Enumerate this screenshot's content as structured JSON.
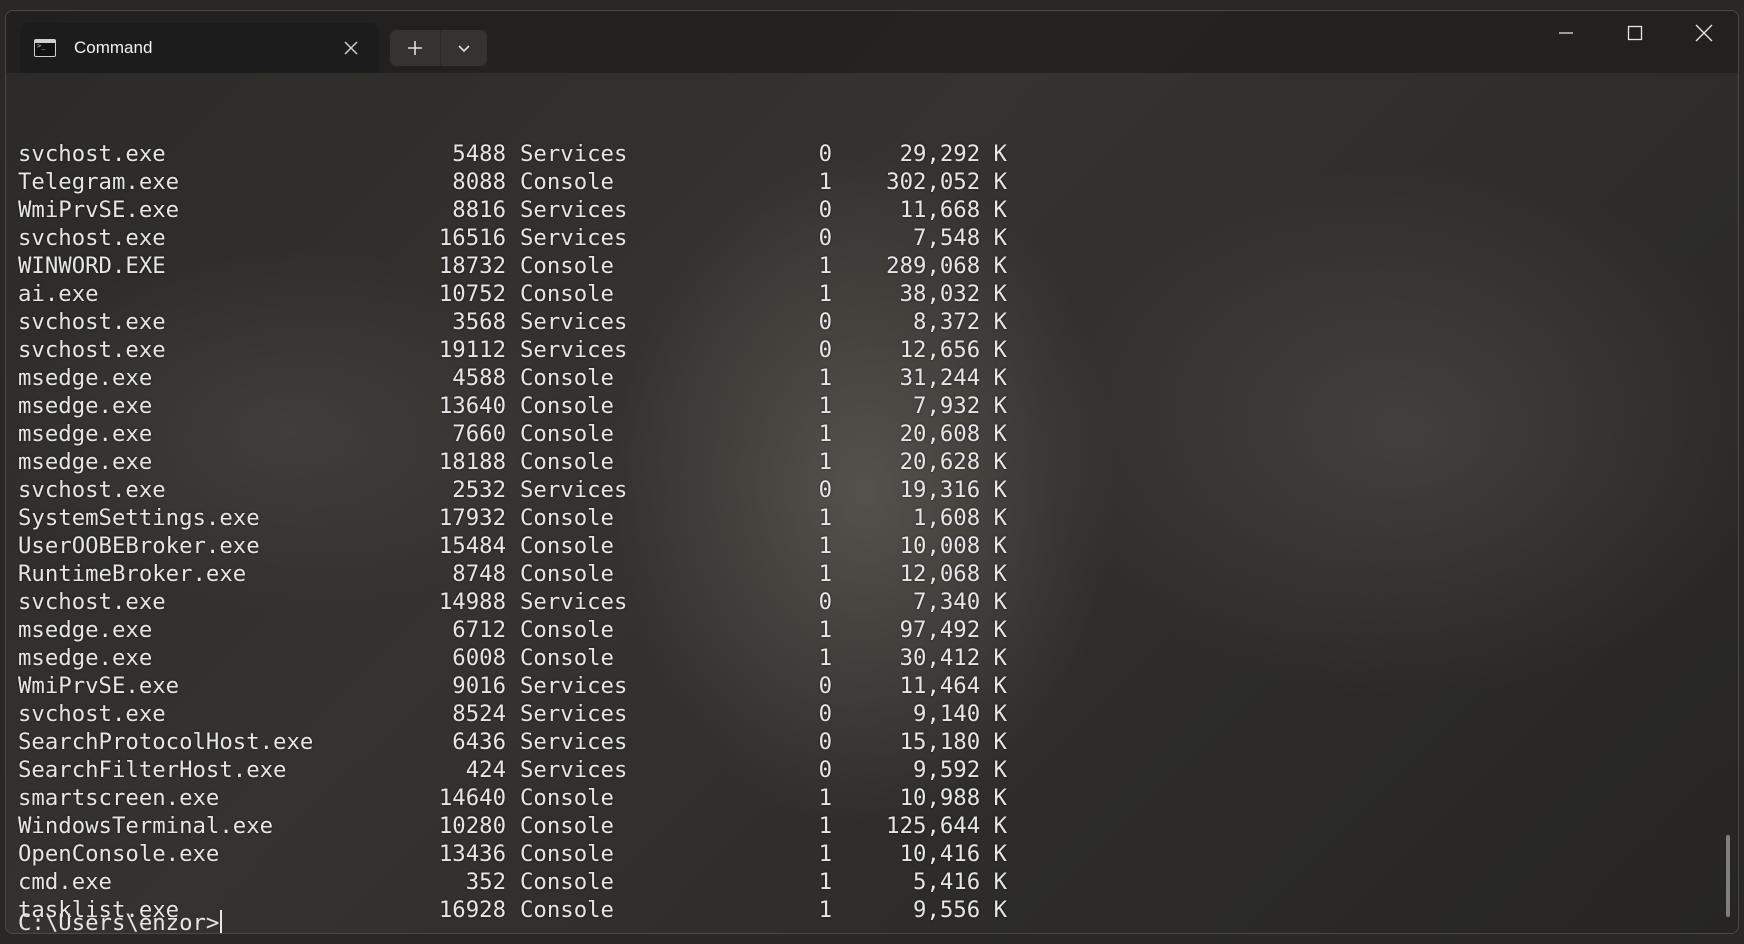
{
  "window": {
    "tab_title": "Command",
    "icons": {
      "tab": "terminal-icon",
      "close_tab": "close-icon",
      "new_tab": "plus-icon",
      "dropdown": "chevron-down-icon",
      "minimize": "minimize-icon",
      "maximize": "maximize-icon",
      "close_window": "close-icon"
    }
  },
  "terminal": {
    "rows": [
      {
        "name": "svchost.exe",
        "pid": "5488",
        "session": "Services",
        "num": "0",
        "mem": "29,292 K"
      },
      {
        "name": "Telegram.exe",
        "pid": "8088",
        "session": "Console",
        "num": "1",
        "mem": "302,052 K"
      },
      {
        "name": "WmiPrvSE.exe",
        "pid": "8816",
        "session": "Services",
        "num": "0",
        "mem": "11,668 K"
      },
      {
        "name": "svchost.exe",
        "pid": "16516",
        "session": "Services",
        "num": "0",
        "mem": "7,548 K"
      },
      {
        "name": "WINWORD.EXE",
        "pid": "18732",
        "session": "Console",
        "num": "1",
        "mem": "289,068 K"
      },
      {
        "name": "ai.exe",
        "pid": "10752",
        "session": "Console",
        "num": "1",
        "mem": "38,032 K"
      },
      {
        "name": "svchost.exe",
        "pid": "3568",
        "session": "Services",
        "num": "0",
        "mem": "8,372 K"
      },
      {
        "name": "svchost.exe",
        "pid": "19112",
        "session": "Services",
        "num": "0",
        "mem": "12,656 K"
      },
      {
        "name": "msedge.exe",
        "pid": "4588",
        "session": "Console",
        "num": "1",
        "mem": "31,244 K"
      },
      {
        "name": "msedge.exe",
        "pid": "13640",
        "session": "Console",
        "num": "1",
        "mem": "7,932 K"
      },
      {
        "name": "msedge.exe",
        "pid": "7660",
        "session": "Console",
        "num": "1",
        "mem": "20,608 K"
      },
      {
        "name": "msedge.exe",
        "pid": "18188",
        "session": "Console",
        "num": "1",
        "mem": "20,628 K"
      },
      {
        "name": "svchost.exe",
        "pid": "2532",
        "session": "Services",
        "num": "0",
        "mem": "19,316 K"
      },
      {
        "name": "SystemSettings.exe",
        "pid": "17932",
        "session": "Console",
        "num": "1",
        "mem": "1,608 K"
      },
      {
        "name": "UserOOBEBroker.exe",
        "pid": "15484",
        "session": "Console",
        "num": "1",
        "mem": "10,008 K"
      },
      {
        "name": "RuntimeBroker.exe",
        "pid": "8748",
        "session": "Console",
        "num": "1",
        "mem": "12,068 K"
      },
      {
        "name": "svchost.exe",
        "pid": "14988",
        "session": "Services",
        "num": "0",
        "mem": "7,340 K"
      },
      {
        "name": "msedge.exe",
        "pid": "6712",
        "session": "Console",
        "num": "1",
        "mem": "97,492 K"
      },
      {
        "name": "msedge.exe",
        "pid": "6008",
        "session": "Console",
        "num": "1",
        "mem": "30,412 K"
      },
      {
        "name": "WmiPrvSE.exe",
        "pid": "9016",
        "session": "Services",
        "num": "0",
        "mem": "11,464 K"
      },
      {
        "name": "svchost.exe",
        "pid": "8524",
        "session": "Services",
        "num": "0",
        "mem": "9,140 K"
      },
      {
        "name": "SearchProtocolHost.exe",
        "pid": "6436",
        "session": "Services",
        "num": "0",
        "mem": "15,180 K"
      },
      {
        "name": "SearchFilterHost.exe",
        "pid": "424",
        "session": "Services",
        "num": "0",
        "mem": "9,592 K"
      },
      {
        "name": "smartscreen.exe",
        "pid": "14640",
        "session": "Console",
        "num": "1",
        "mem": "10,988 K"
      },
      {
        "name": "WindowsTerminal.exe",
        "pid": "10280",
        "session": "Console",
        "num": "1",
        "mem": "125,644 K"
      },
      {
        "name": "OpenConsole.exe",
        "pid": "13436",
        "session": "Console",
        "num": "1",
        "mem": "10,416 K"
      },
      {
        "name": "cmd.exe",
        "pid": "352",
        "session": "Console",
        "num": "1",
        "mem": "5,416 K"
      },
      {
        "name": "tasklist.exe",
        "pid": "16928",
        "session": "Console",
        "num": "1",
        "mem": "9,556 K"
      }
    ],
    "prompt": "C:\\Users\\enzor>"
  }
}
